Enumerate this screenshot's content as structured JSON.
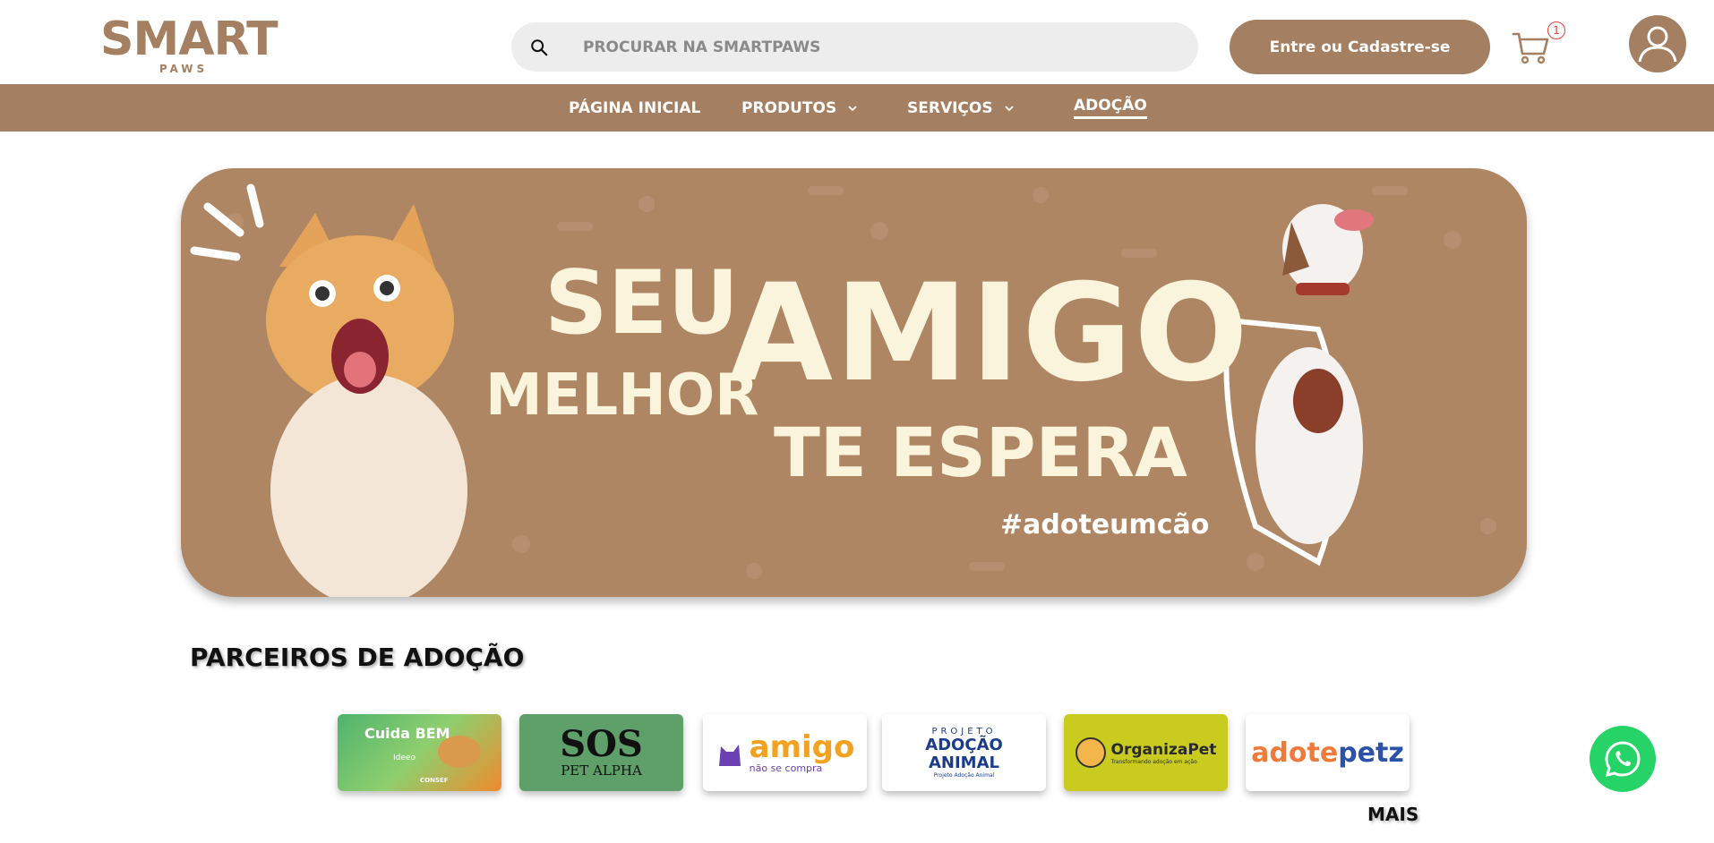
{
  "header": {
    "logo_text": "SMART",
    "logo_sub": "PAWS",
    "search_placeholder": "PROCURAR NA SMARTPAWS",
    "login_label": "Entre ou Cadastre-se",
    "cart_count": "1"
  },
  "nav": {
    "items": [
      {
        "label": "PÁGINA INICIAL"
      },
      {
        "label": "PRODUTOS"
      },
      {
        "label": "SERVIÇOS"
      },
      {
        "label": "ADOÇÃO"
      }
    ]
  },
  "banner": {
    "line_seu": "SEU",
    "line_melhor": "MELHOR",
    "line_amigo": "AMIGO",
    "line_espera": "TE ESPERA",
    "hashtag": "#adoteumcão",
    "colors": {
      "background": "#ae8664",
      "text": "#fbf4dc"
    }
  },
  "partners": {
    "title": "PARCEIROS DE ADOÇÃO",
    "more_label": "MAIS",
    "items": [
      {
        "name": "Cuida BEM",
        "tag": "Ideeo",
        "note": "CONSEF"
      },
      {
        "name": "SOS",
        "sub": "PET ALPHA"
      },
      {
        "name": "amigo",
        "sub": "não se compra"
      },
      {
        "name": "PROJETO",
        "sub": "ADOÇÃO ANIMAL",
        "foot": "Projeto Adoção Animal"
      },
      {
        "name": "OrganizaPet",
        "sub": "Transformando adoção em ação"
      },
      {
        "name_a": "adote",
        "name_b": "petz"
      }
    ]
  },
  "colors": {
    "brand": "#a47f61",
    "whatsapp": "#25d366",
    "badge": "#e0433a"
  }
}
